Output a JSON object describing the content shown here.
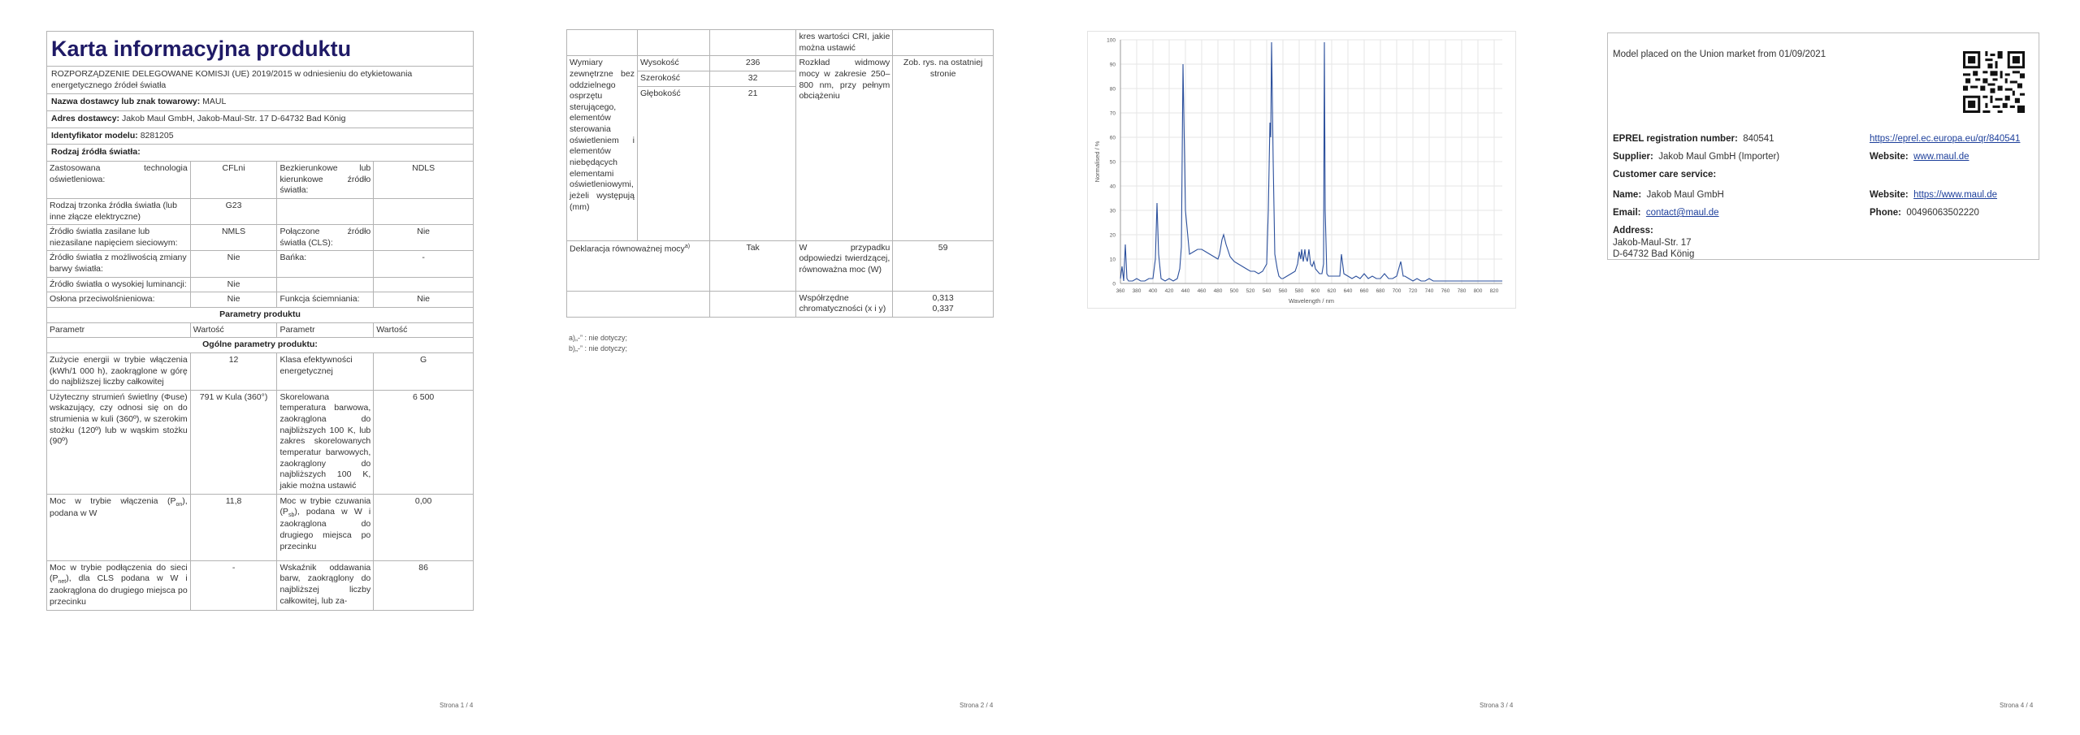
{
  "page1": {
    "title": "Karta informacyjna produktu",
    "regulation": "ROZPORZĄDZENIE DELEGOWANE KOMISJI (UE) 2019/2015 w odniesieniu do etykietowania energetycznego źródeł światła",
    "supplier_name_label": "Nazwa dostawcy lub znak towarowy:",
    "supplier_name": "MAUL",
    "supplier_address_label": "Adres dostawcy:",
    "supplier_address": "Jakob Maul GmbH, Jakob-Maul-Str. 17 D-64732 Bad König",
    "model_id_label": "Identyfikator modelu:",
    "model_id": "8281205",
    "light_type_label": "Rodzaj źródła światła:",
    "r1": {
      "l1": "Zastosowana technologia oświetleniowa:",
      "v1": "CFLni",
      "l2": "Bezkierunkowe lub kierunkowe źródło światła:",
      "v2": "NDLS"
    },
    "r2": {
      "l1": "Rodzaj trzonka źródła światła (lub inne złącze elektryczne)",
      "v1": "G23"
    },
    "r3": {
      "l1": "Źródło światła zasilane lub niezasilane napięciem sieciowym:",
      "v1": "NMLS",
      "l2": "Połączone źródło światła (CLS):",
      "v2": "Nie"
    },
    "r4": {
      "l1": "Źródło światła z możliwością zmiany barwy światła:",
      "v1": "Nie",
      "l2": "Bańka:",
      "v2": "-"
    },
    "r5": {
      "l1": "Źródło światła o wysokiej luminancji:",
      "v1": "Nie"
    },
    "r6": {
      "l1": "Osłona przeciwolśnieniowa:",
      "v1": "Nie",
      "l2": "Funkcja ściemniania:",
      "v2": "Nie"
    },
    "params_header": "Parametry produktu",
    "col_param": "Parametr",
    "col_value": "Wartość",
    "general_header": "Ogólne parametry produktu:",
    "p1": {
      "l1": "Zużycie energii w trybie włączenia (kWh/1 000 h), zaokrąglone w górę do najbliższej liczby całkowitej",
      "v1": "12",
      "l2": "Klasa efektywności energetycznej",
      "v2": "G"
    },
    "p2": {
      "l1": "Użyteczny strumień świetlny (Φuse) wskazujący, czy odnosi się on do strumienia w kuli (360º), w szerokim stożku (120º) lub w wąskim stożku (90º)",
      "v1": "791 w Kula (360°)",
      "l2": "Skorelowana temperatura barwowa, zaokrąglona do najbliższych 100 K, lub zakres skorelowanych temperatur barwowych, zaokrąglony do najbliższych 100 K, jakie można ustawić",
      "v2": "6 500"
    },
    "p3": {
      "l1a": "Moc w trybie włączenia (P",
      "l1s": "on",
      "l1b": "), podana w W",
      "v1": "11,8",
      "l2a": "Moc w trybie czuwania (P",
      "l2s": "sb",
      "l2b": "), podana w W i zaokrąglona do drugiego miejsca po przecinku",
      "v2": "0,00"
    },
    "p4": {
      "l1a": "Moc w trybie podłączenia do sieci (P",
      "l1s": "net",
      "l1b": "), dla CLS podana w W i zaokrąglona do drugiego miejsca po przecinku",
      "v1": "-",
      "l2": "Wskaźnik oddawania barw, zaokrąglony do najbliższej liczby całkowitej, lub za-",
      "v2": "86"
    },
    "page_num": "Strona 1 / 4"
  },
  "page2": {
    "cont": "kres wartości CRI, jakie można ustawić",
    "dims_label": "Wymiary zewnętrzne bez oddzielnego osprzętu sterującego, elementów sterowania oświetleniem i elementów niebędących elementami oświetleniowymi, jeżeli występują (mm)",
    "h_label": "Wysokość",
    "h": "236",
    "w_label": "Szerokość",
    "w": "32",
    "d_label": "Głębokość",
    "d": "21",
    "spd_label": "Rozkład widmowy mocy w zakresie 250–800 nm, przy pełnym obciążeniu",
    "spd_value": "Zob. rys. na ostatniej stronie",
    "eq_label": "Deklaracja równoważnej mocy",
    "eq_sup": "a)",
    "eq_value": "Tak",
    "eq2_label": "W przypadku odpowiedzi twierdzącej, równoważna moc (W)",
    "eq2_value": "59",
    "chrom_label": "Współrzędne chromatyczności (x i y)",
    "chrom_x": "0,313",
    "chrom_y": "0,337",
    "note_a": "a)„-” : nie dotyczy;",
    "note_b": "b)„-” : nie dotyczy;",
    "page_num": "Strona 2 / 4"
  },
  "page3": {
    "page_num": "Strona 3 / 4"
  },
  "chart_data": {
    "type": "line",
    "xlabel": "Wavelength / nm",
    "ylabel": "Normalised / %",
    "xlim": [
      360,
      830
    ],
    "ylim": [
      0,
      100
    ],
    "xticks": [
      360,
      380,
      400,
      420,
      440,
      460,
      480,
      500,
      520,
      540,
      560,
      580,
      600,
      620,
      640,
      660,
      680,
      700,
      720,
      740,
      760,
      780,
      800,
      820
    ],
    "yticks": [
      0,
      10,
      20,
      30,
      40,
      50,
      60,
      70,
      80,
      90,
      100
    ],
    "grid": true,
    "line_color": "#2b4f9c",
    "x": [
      360,
      362,
      364,
      366,
      368,
      370,
      375,
      380,
      385,
      390,
      395,
      400,
      403,
      405,
      407,
      410,
      415,
      420,
      425,
      430,
      433,
      435,
      437,
      440,
      445,
      450,
      455,
      460,
      465,
      470,
      475,
      480,
      482,
      485,
      487,
      490,
      495,
      500,
      505,
      510,
      515,
      520,
      525,
      530,
      535,
      540,
      542,
      544,
      545,
      546,
      548,
      550,
      553,
      555,
      558,
      560,
      565,
      570,
      575,
      578,
      580,
      582,
      583,
      585,
      587,
      588,
      590,
      592,
      594,
      596,
      598,
      600,
      605,
      608,
      610,
      611,
      612,
      614,
      616,
      620,
      625,
      630,
      632,
      635,
      640,
      645,
      650,
      655,
      660,
      665,
      670,
      675,
      680,
      685,
      690,
      695,
      700,
      705,
      708,
      710,
      715,
      720,
      725,
      730,
      735,
      740,
      745,
      750,
      755,
      760,
      765,
      770,
      775,
      780,
      785,
      790,
      795,
      800,
      805,
      810,
      815,
      820,
      825,
      830
    ],
    "y": [
      2,
      7,
      1,
      16,
      2,
      1,
      1,
      2,
      1,
      1,
      2,
      2,
      10,
      33,
      12,
      2,
      1,
      2,
      1,
      2,
      6,
      15,
      90,
      30,
      12,
      13,
      14,
      14,
      13,
      12,
      11,
      10,
      12,
      18,
      20,
      16,
      11,
      9,
      8,
      7,
      6,
      5,
      5,
      4,
      5,
      8,
      30,
      66,
      60,
      99,
      50,
      12,
      6,
      3,
      2,
      2,
      3,
      4,
      5,
      8,
      13,
      10,
      14,
      9,
      14,
      11,
      9,
      14,
      8,
      7,
      9,
      6,
      4,
      4,
      8,
      99,
      30,
      4,
      3,
      3,
      3,
      3,
      12,
      4,
      3,
      2,
      3,
      2,
      4,
      2,
      3,
      2,
      2,
      4,
      2,
      2,
      3,
      9,
      3,
      3,
      2,
      1,
      2,
      1,
      1,
      2,
      1,
      1,
      1,
      1,
      1,
      1,
      1,
      1,
      1,
      1,
      1,
      1,
      1,
      1,
      1,
      1,
      1,
      1
    ]
  },
  "page4": {
    "placed": "Model placed on the Union market from 01/09/2021",
    "eprel_label": "EPREL registration number:",
    "eprel": "840541",
    "eprel_link": "https://eprel.ec.europa.eu/qr/840541",
    "supplier_label": "Supplier:",
    "supplier": "Jakob Maul GmbH (Importer)",
    "website_label": "Website:",
    "website": "www.maul.de",
    "care_label": "Customer care service:",
    "name_label": "Name:",
    "name": "Jakob Maul GmbH",
    "care_website_label": "Website:",
    "care_website": "https://www.maul.de",
    "email_label": "Email:",
    "email": "contact@maul.de",
    "phone_label": "Phone:",
    "phone": "00496063502220",
    "address_label": "Address:",
    "address1": "Jakob-Maul-Str. 17",
    "address2": "D-64732 Bad König",
    "qr_icon": "qr-code-icon",
    "page_num": "Strona 4 / 4"
  }
}
